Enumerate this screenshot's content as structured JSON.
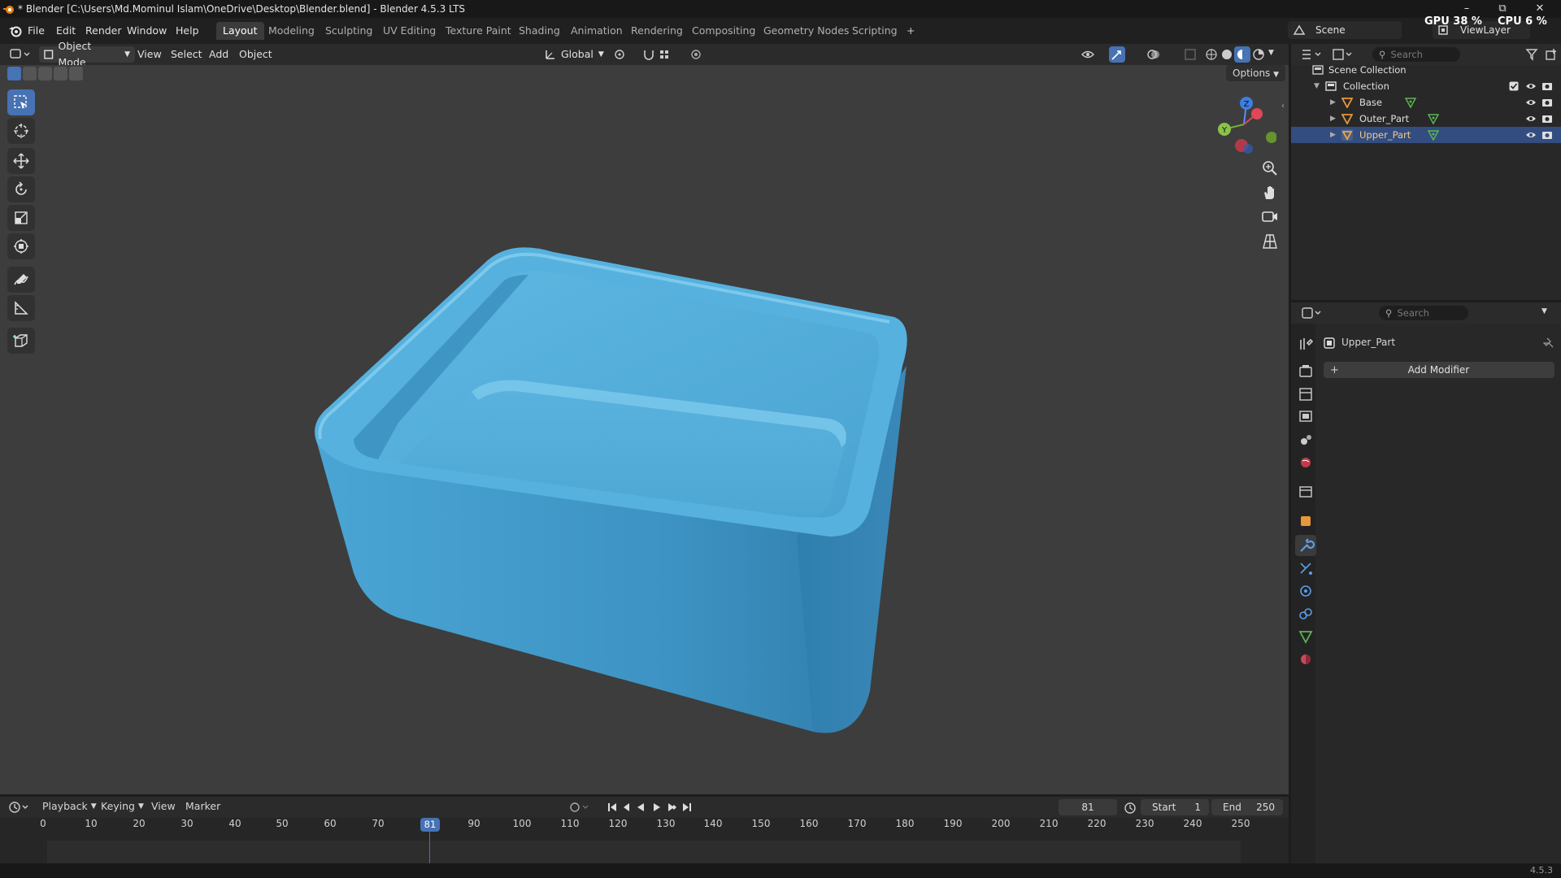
{
  "window": {
    "title": "* Blender [C:\\Users\\Md.Mominul Islam\\OneDrive\\Desktop\\Blender.blend] - Blender 4.5.3 LTS",
    "minimize": "–",
    "maximize": "⧉",
    "close": "✕"
  },
  "menus": [
    "File",
    "Edit",
    "Render",
    "Window",
    "Help"
  ],
  "workspace_tabs": [
    "Layout",
    "Modeling",
    "Sculpting",
    "UV Editing",
    "Texture Paint",
    "Shading",
    "Animation",
    "Rendering",
    "Compositing",
    "Geometry Nodes",
    "Scripting"
  ],
  "active_workspace": "Layout",
  "add_workspace": "+",
  "scene": {
    "name": "Scene",
    "view_layer": "ViewLayer"
  },
  "stats": {
    "gpu_label": "GPU",
    "gpu_value": "38 %",
    "cpu_label": "CPU",
    "cpu_value": "6 %"
  },
  "viewport_header": {
    "mode": "Object Mode",
    "menus": [
      "View",
      "Select",
      "Add",
      "Object"
    ],
    "orientation": "Global",
    "options": "Options"
  },
  "outliner": {
    "search_placeholder": "Search",
    "scene_collection": "Scene Collection",
    "collection": "Collection",
    "items": [
      {
        "name": "Base",
        "selected": false
      },
      {
        "name": "Outer_Part",
        "selected": false
      },
      {
        "name": "Upper_Part",
        "selected": true
      }
    ]
  },
  "properties": {
    "search_placeholder": "Search",
    "object_name": "Upper_Part",
    "add_modifier": "Add Modifier"
  },
  "timeline": {
    "menus": [
      "Playback",
      "Keying",
      "View",
      "Marker"
    ],
    "current_frame": "81",
    "start_label": "Start",
    "start_value": "1",
    "end_label": "End",
    "end_value": "250",
    "ticks": [
      "0",
      "10",
      "20",
      "30",
      "40",
      "50",
      "60",
      "70",
      "81",
      "90",
      "100",
      "110",
      "120",
      "130",
      "140",
      "150",
      "160",
      "170",
      "180",
      "190",
      "200",
      "210",
      "220",
      "230",
      "240",
      "250"
    ]
  },
  "status": {
    "version": "4.5.3"
  },
  "colors": {
    "accent": "#4772b3",
    "mesh": "#4aa6d6",
    "selected_row": "#334d80",
    "orange": "#e8983a",
    "green": "#5ab552"
  }
}
